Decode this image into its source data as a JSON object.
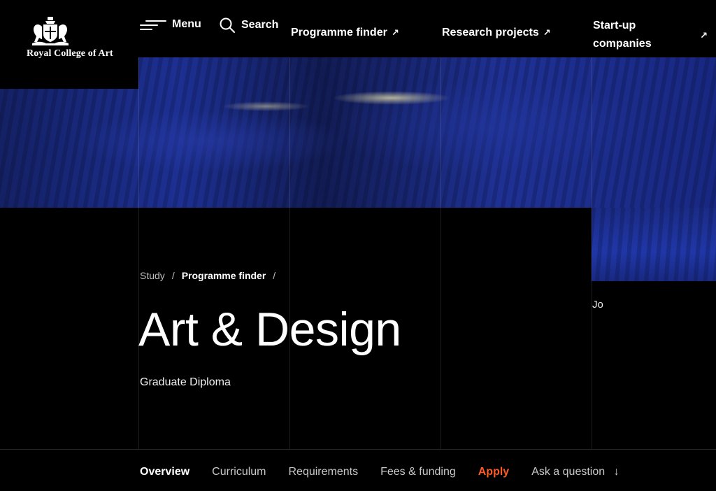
{
  "brand": {
    "name": "Royal College of Art"
  },
  "header": {
    "menu_label": "Menu",
    "search_label": "Search",
    "links": [
      {
        "label": "Programme finder",
        "arrow": "↗"
      },
      {
        "label": "Research projects",
        "arrow": "↗"
      },
      {
        "label_line1": "Start-up",
        "label_line2": "companies",
        "arrow": "↗"
      }
    ]
  },
  "breadcrumb": {
    "items": [
      "Study",
      "Programme finder"
    ],
    "separator": "/"
  },
  "page": {
    "title": "Art & Design",
    "subtitle": "Graduate Diploma",
    "side_text": "Jo"
  },
  "tabs": {
    "items": [
      {
        "label": "Overview",
        "state": "active"
      },
      {
        "label": "Curriculum"
      },
      {
        "label": "Requirements"
      },
      {
        "label": "Fees & funding"
      },
      {
        "label": "Apply",
        "state": "accent"
      },
      {
        "label": "Ask a question",
        "icon": "↓"
      }
    ]
  },
  "colors": {
    "background": "#000000",
    "accent": "#ff5a1f",
    "hero_blue": "#1a2d8f"
  }
}
